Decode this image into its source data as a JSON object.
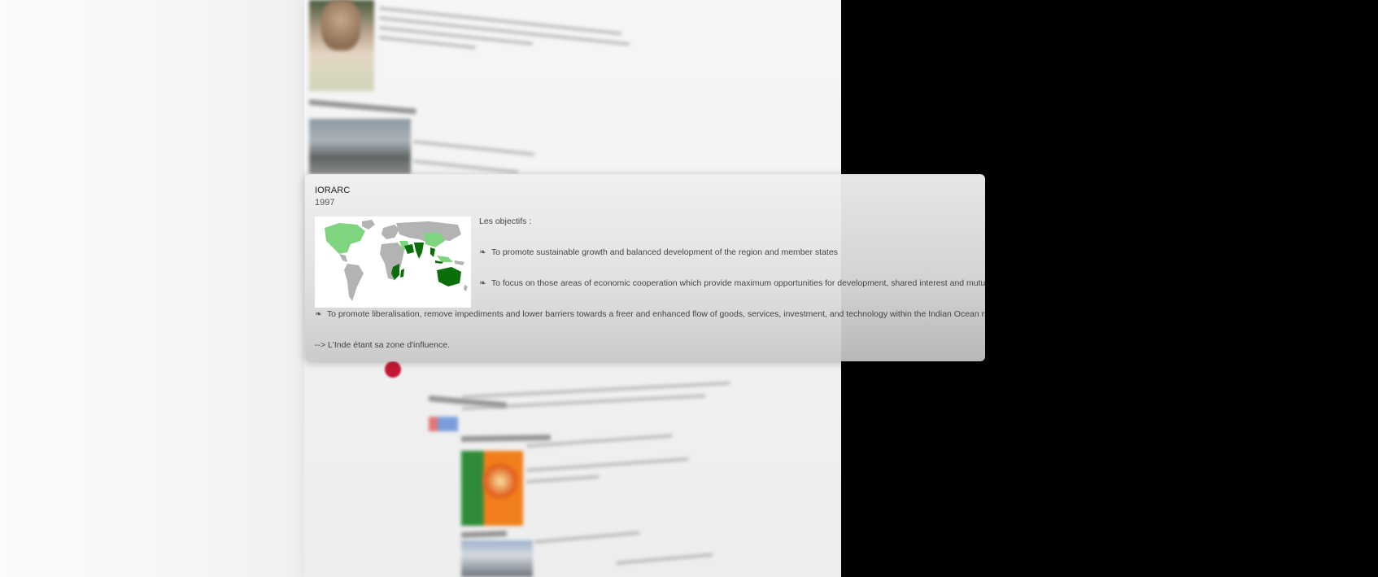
{
  "popup": {
    "title": "IORARC",
    "year": "1997",
    "objectives_label": "Les objectifs :",
    "bullet_glyph": "❧",
    "objective_1": "To promote sustainable growth and balanced development of the region  and member states",
    "objective_2": "To focus on those areas of economic cooperation which provide maximum  opportunities for development, shared interest and mutual benefits",
    "objective_3": "To promote liberalisation, remove impediments and lower barriers towards  a freer and enhanced flow of goods, services, investment, and technology  within the Indian Ocean rim.",
    "conclusion": "--> L'Inde étant sa zone d'influence.",
    "map_icon": "world-map-member-states",
    "colors": {
      "member_dark": "#0a6e0a",
      "member_light": "#7fd47f",
      "land": "#b3b3b3"
    }
  },
  "background": {
    "accent_red": "#c61836"
  }
}
